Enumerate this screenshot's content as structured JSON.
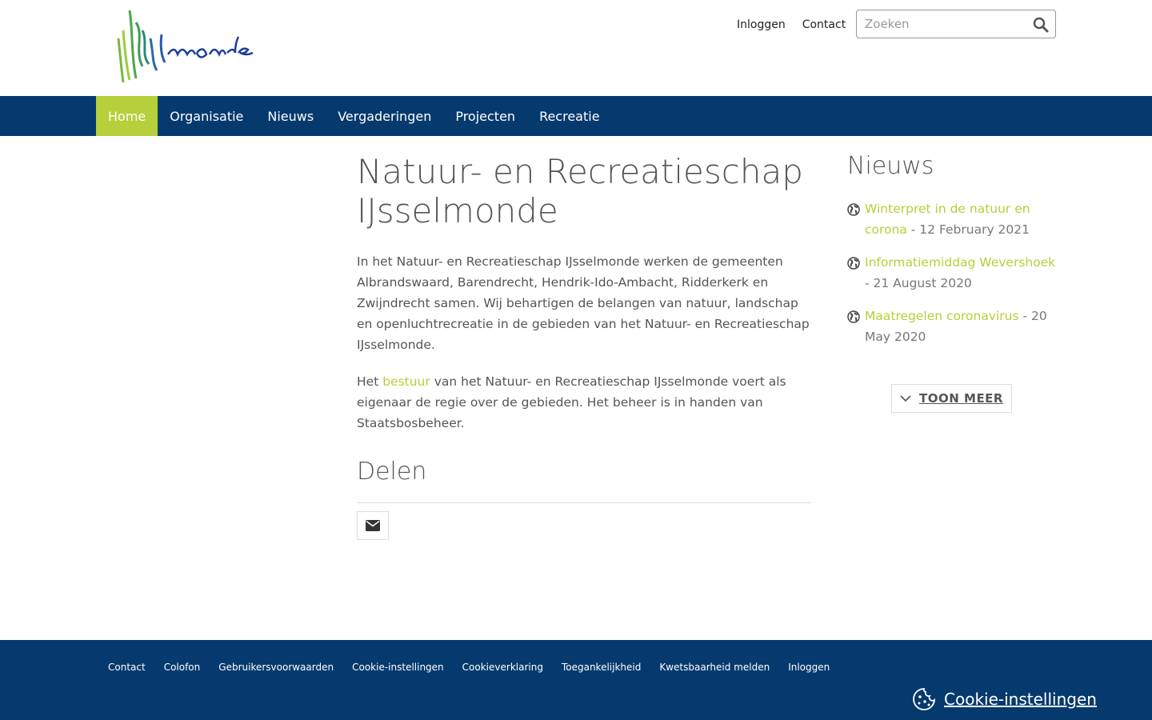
{
  "header": {
    "logo_alt": "IJsselmonde",
    "links": [
      "Inloggen",
      "Contact"
    ],
    "search_placeholder": "Zoeken"
  },
  "nav": {
    "items": [
      "Home",
      "Organisatie",
      "Nieuws",
      "Vergaderingen",
      "Projecten",
      "Recreatie"
    ],
    "active": "Home",
    "bg_color": "#063a6e",
    "active_color": "#b7cf3a"
  },
  "main": {
    "title": "Natuur- en Recreatieschap IJsselmonde",
    "intro": "In het Natuur- en Recreatieschap IJsselmonde werken de gemeenten Albrandswaard, Barendrecht, Hendrik-Ido-Ambacht, Ridderkerk en Zwijndrecht samen. Wij behartigen de belangen van natuur, landschap en openluchtrecreatie in de gebieden van het Natuur- en Recreatieschap IJsselmonde.",
    "p2_before": "Het ",
    "p2_link": "bestuur",
    "p2_after": " van het Natuur- en Recreatieschap IJsselmonde voert als eigenaar de regie over de gebieden. Het beheer is in handen van Staatsbosbeheer.",
    "share_title": "Delen",
    "share_icon": "mail-icon"
  },
  "sidebar": {
    "title": "Nieuws",
    "items": [
      {
        "title": "Winterpret in de natuur en corona",
        "date": " - 12 February 2021"
      },
      {
        "title": "Informatiemiddag Wevershoek",
        "date": " - 21 August 2020"
      },
      {
        "title": "Maatregelen coronavirus",
        "date": " - 20 May 2020"
      }
    ],
    "more_label": "TOON MEER"
  },
  "footer": {
    "links": [
      "Contact",
      "Colofon",
      "Gebruikersvoorwaarden",
      "Cookie-instellingen",
      "Cookieverklaring",
      "Toegankelijkheid",
      "Kwetsbaarheid melden",
      "Inloggen"
    ],
    "cookie_label": "Cookie-instellingen"
  }
}
